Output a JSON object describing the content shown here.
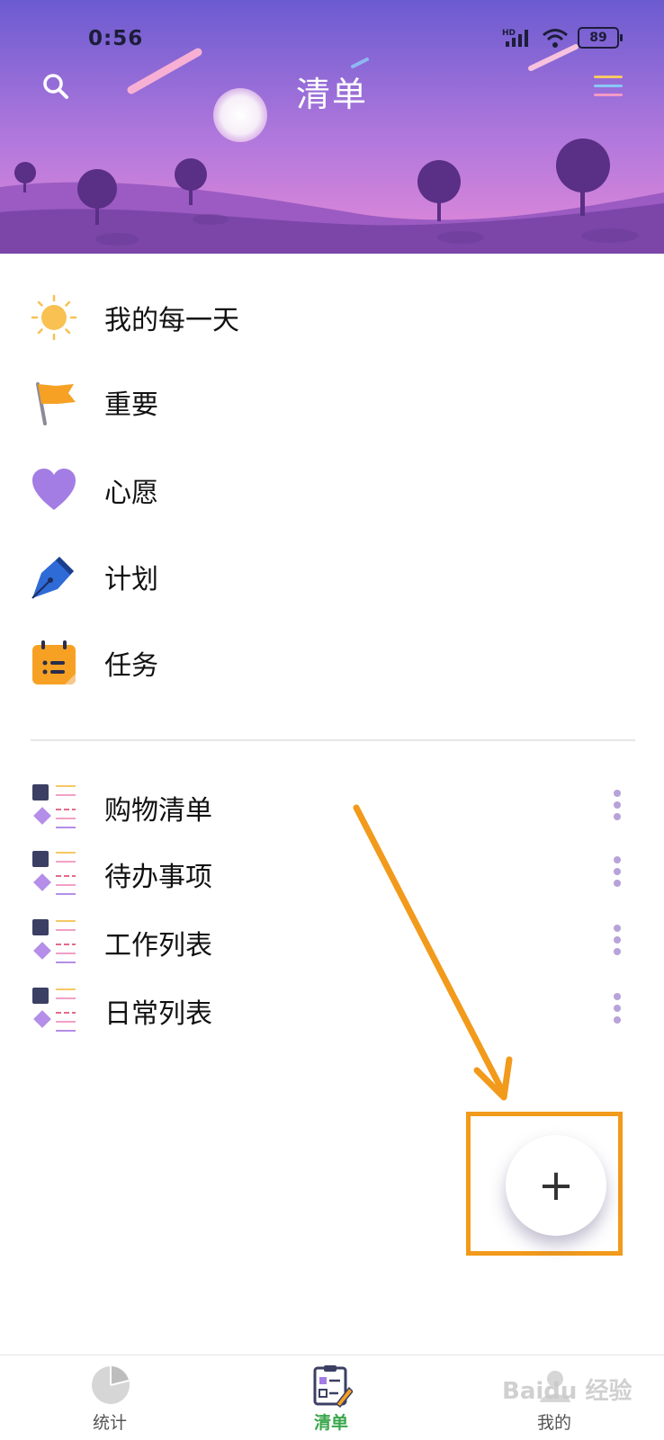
{
  "status_bar": {
    "time": "0:56",
    "network": "HD",
    "battery": "89"
  },
  "header": {
    "title": "清单"
  },
  "smart_lists": [
    {
      "label": "我的每一天",
      "icon": "sun-icon"
    },
    {
      "label": "重要",
      "icon": "flag-icon"
    },
    {
      "label": "心愿",
      "icon": "heart-icon"
    },
    {
      "label": "计划",
      "icon": "pen-nib-icon"
    },
    {
      "label": "任务",
      "icon": "calendar-icon"
    }
  ],
  "user_lists": [
    {
      "label": "购物清单"
    },
    {
      "label": "待办事项"
    },
    {
      "label": "工作列表"
    },
    {
      "label": "日常列表"
    }
  ],
  "fab": {
    "label": "+"
  },
  "bottom_nav": [
    {
      "label": "统计",
      "icon": "pie-chart-icon",
      "active": false
    },
    {
      "label": "清单",
      "icon": "checklist-icon",
      "active": true
    },
    {
      "label": "我的",
      "icon": "profile-icon",
      "active": false
    }
  ],
  "watermark": "Baidu 经验",
  "colors": {
    "accent": "#3aa64b",
    "annotation": "#f29a1b",
    "header_top": "#8a67d6",
    "header_bottom": "#c57ad8"
  }
}
